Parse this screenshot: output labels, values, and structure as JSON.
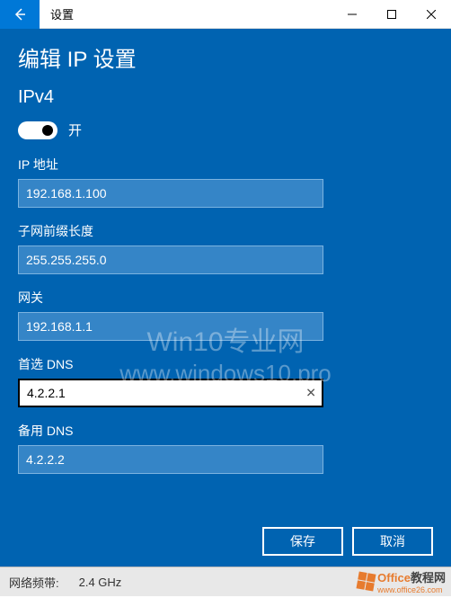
{
  "window": {
    "title": "设置"
  },
  "page": {
    "title": "编辑 IP 设置",
    "section": "IPv4",
    "toggle_label": "开"
  },
  "fields": {
    "ip_label": "IP 地址",
    "ip_value": "192.168.1.100",
    "subnet_label": "子网前缀长度",
    "subnet_value": "255.255.255.0",
    "gateway_label": "网关",
    "gateway_value": "192.168.1.1",
    "dns1_label": "首选 DNS",
    "dns1_value": "4.2.2.1",
    "dns2_label": "备用 DNS",
    "dns2_value": "4.2.2.2"
  },
  "buttons": {
    "save": "保存",
    "cancel": "取消"
  },
  "watermark": {
    "line1": "Win10专业网",
    "line2": "www.windows10.pro"
  },
  "statusbar": {
    "label": "网络频带:",
    "value": "2.4 GHz"
  },
  "corner_logo": {
    "text1": "Office",
    "text2": "教程网",
    "url": "www.office26.com"
  }
}
